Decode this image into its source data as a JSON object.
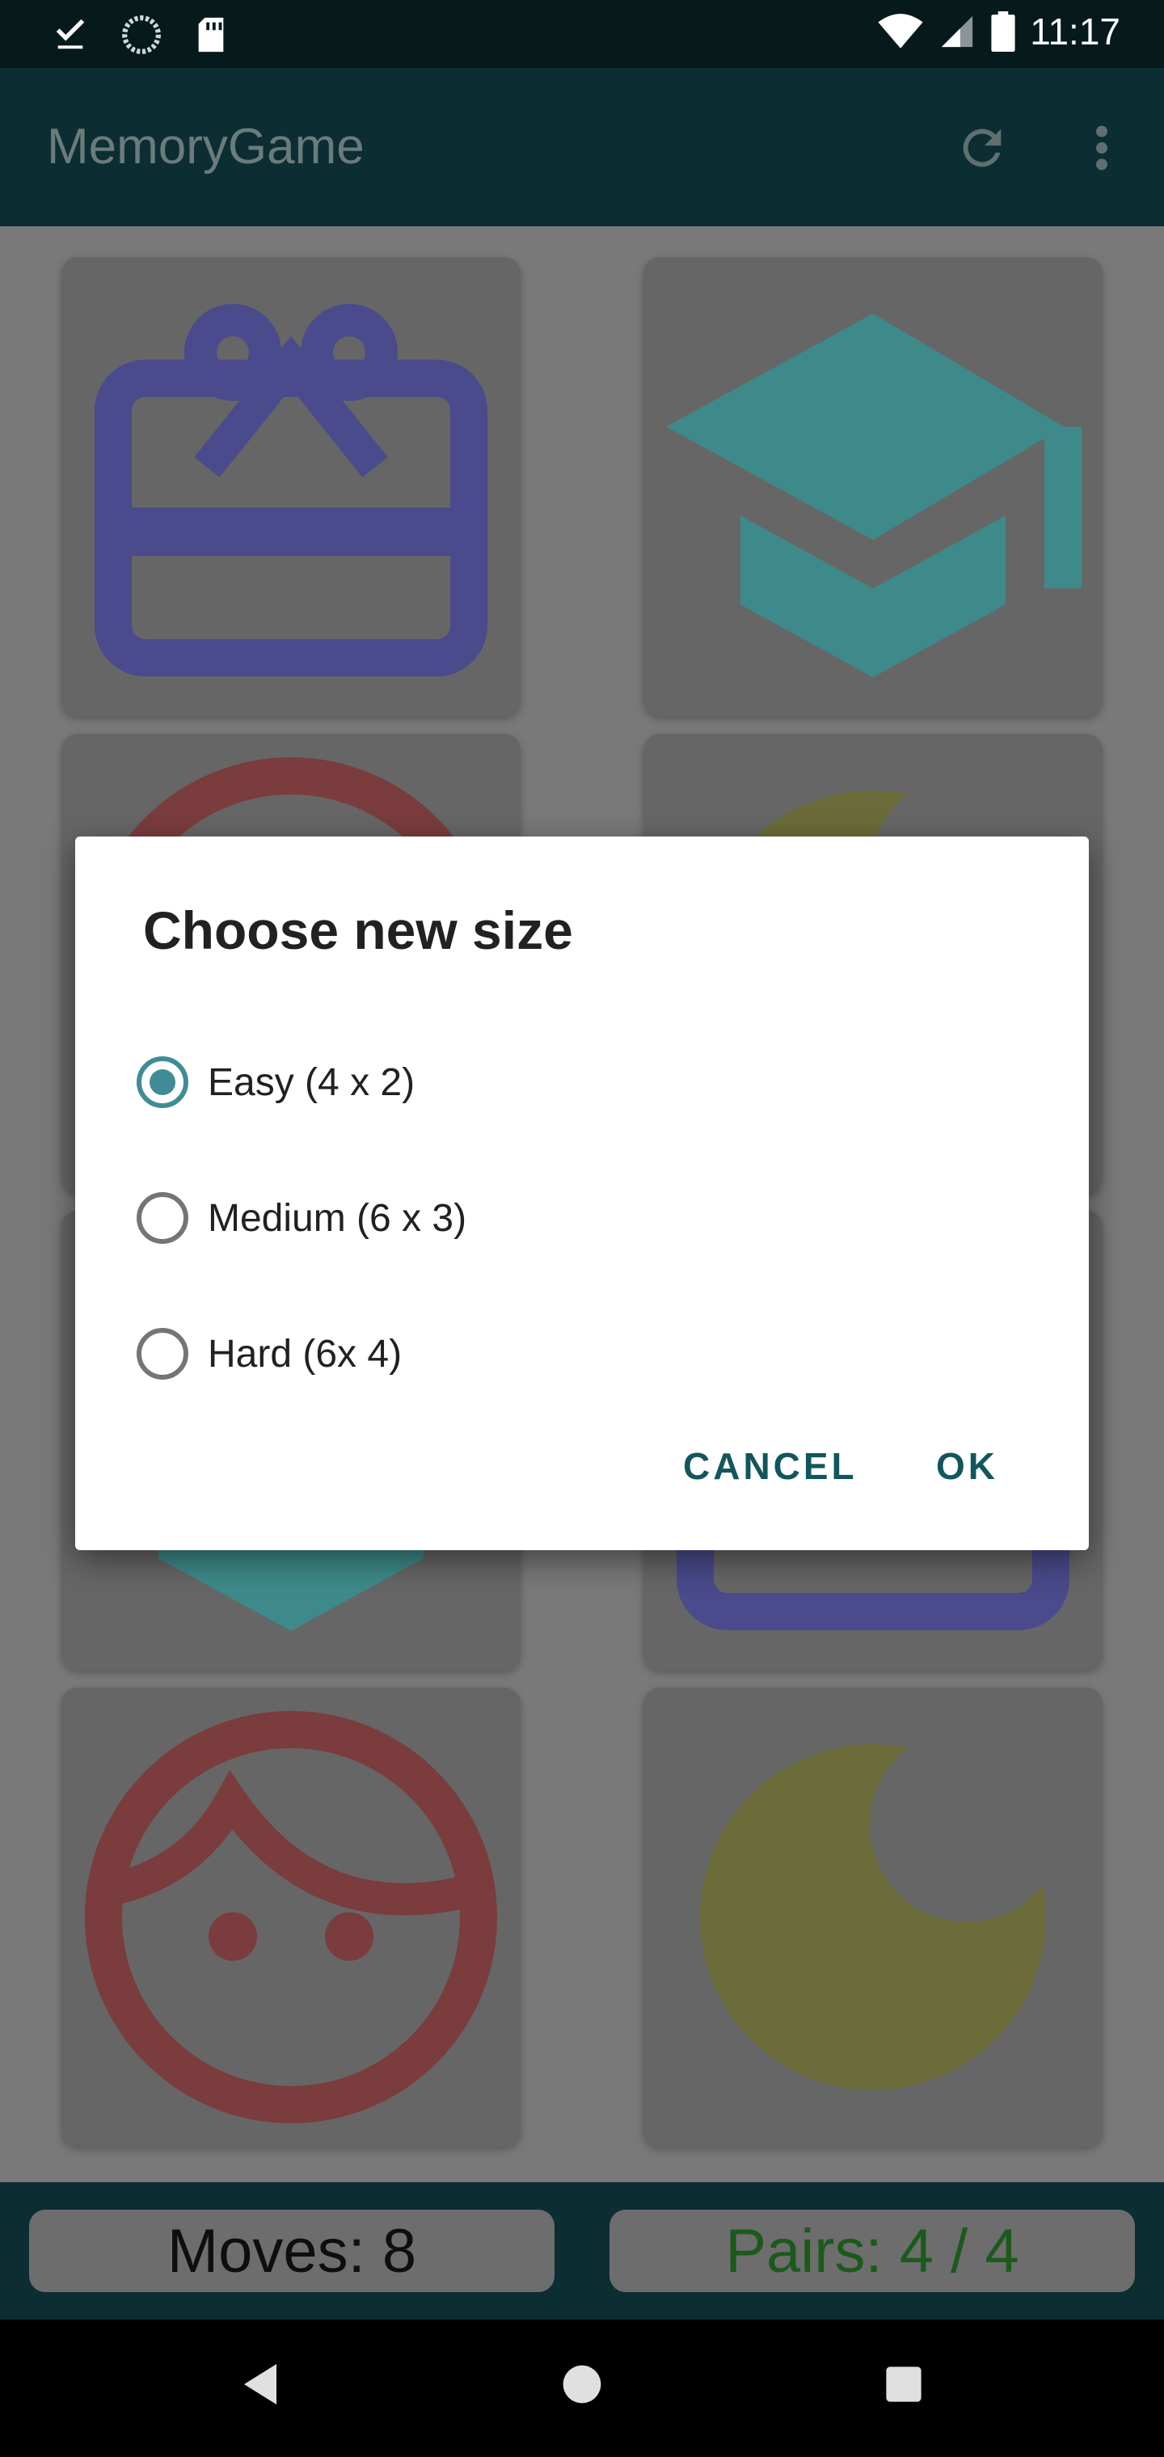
{
  "status_bar": {
    "time": "11:17",
    "left_icons": [
      "download-done-icon",
      "sync-icon",
      "sd-card-icon"
    ],
    "right_icons": [
      "wifi-icon",
      "cell-signal-icon",
      "battery-icon"
    ]
  },
  "app_bar": {
    "title": "MemoryGame",
    "actions": [
      "refresh-icon",
      "more-vert-icon"
    ]
  },
  "tiles": [
    {
      "icon": "gift-card-icon",
      "color": "#4a4a8c"
    },
    {
      "icon": "graduation-cap-icon",
      "color": "#3e8a8a"
    },
    {
      "icon": "face-icon",
      "color": "#7a3c3c"
    },
    {
      "icon": "moon-icon",
      "color": "#6b6b3a"
    },
    {
      "icon": "graduation-cap-icon",
      "color": "#3e8a8a"
    },
    {
      "icon": "gift-card-icon",
      "color": "#4a4a8c"
    },
    {
      "icon": "face-icon",
      "color": "#7a3c3c"
    },
    {
      "icon": "moon-icon",
      "color": "#6b6b3a"
    }
  ],
  "footer": {
    "moves": "Moves: 8",
    "pairs": "Pairs: 4 / 4"
  },
  "dialog": {
    "title": "Choose new size",
    "options": [
      {
        "label": "Easy (4 x 2)",
        "checked": true
      },
      {
        "label": "Medium (6 x 3)",
        "checked": false
      },
      {
        "label": "Hard (6x 4)",
        "checked": false
      }
    ],
    "cancel_label": "CANCEL",
    "ok_label": "OK"
  },
  "colors": {
    "accent": "#3f8c96",
    "button_text": "#11565d",
    "app_bar": "#0c2e32",
    "status_bar": "#06191b"
  }
}
